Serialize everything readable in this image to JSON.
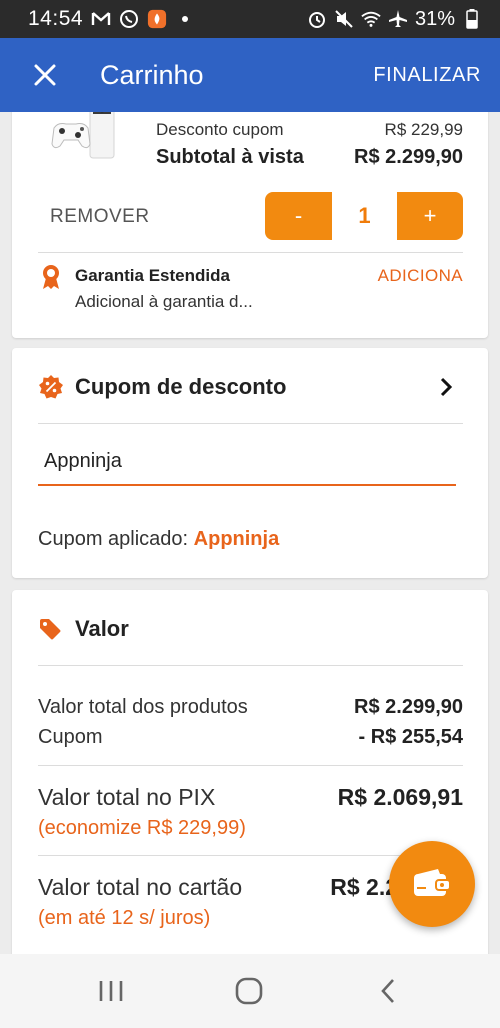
{
  "status_bar": {
    "time": "14:54",
    "battery": "31%"
  },
  "app_bar": {
    "title": "Carrinho",
    "action": "FINALIZAR"
  },
  "product": {
    "discount_label": "Desconto cupom",
    "discount_value": "R$ 229,99",
    "subtotal_label": "Subtotal à vista",
    "subtotal_value": "R$ 2.299,90",
    "remove_label": "REMOVER",
    "minus_label": "-",
    "quantity": "1",
    "plus_label": "+",
    "warranty_title": "Garantia Estendida",
    "warranty_desc": "Adicional à garantia d...",
    "warranty_action": "ADICIONA"
  },
  "coupon": {
    "title": "Cupom de desconto",
    "input_value": "Appninja",
    "applied_label": "Cupom aplicado:",
    "applied_code": "Appninja"
  },
  "valor": {
    "title": "Valor",
    "products_label": "Valor total dos produtos",
    "products_value": "R$ 2.299,90",
    "coupon_label": "Cupom",
    "coupon_value": "- R$ 255,54",
    "pix_label": "Valor total no PIX",
    "pix_value": "R$ 2.069,91",
    "pix_note": "(economize R$ 229,99)",
    "card_label": "Valor total no cartão",
    "card_value": "R$ 2.2",
    "card_note": "(em até 12 s/ juros)"
  },
  "colors": {
    "app_bar": "#2f62c4",
    "accent": "#f28a10",
    "accent_text": "#e8641b"
  },
  "icons": [
    "close-icon",
    "chevron-right-icon",
    "ribbon-icon",
    "percent-badge-icon",
    "tag-icon",
    "wallet-icon"
  ]
}
